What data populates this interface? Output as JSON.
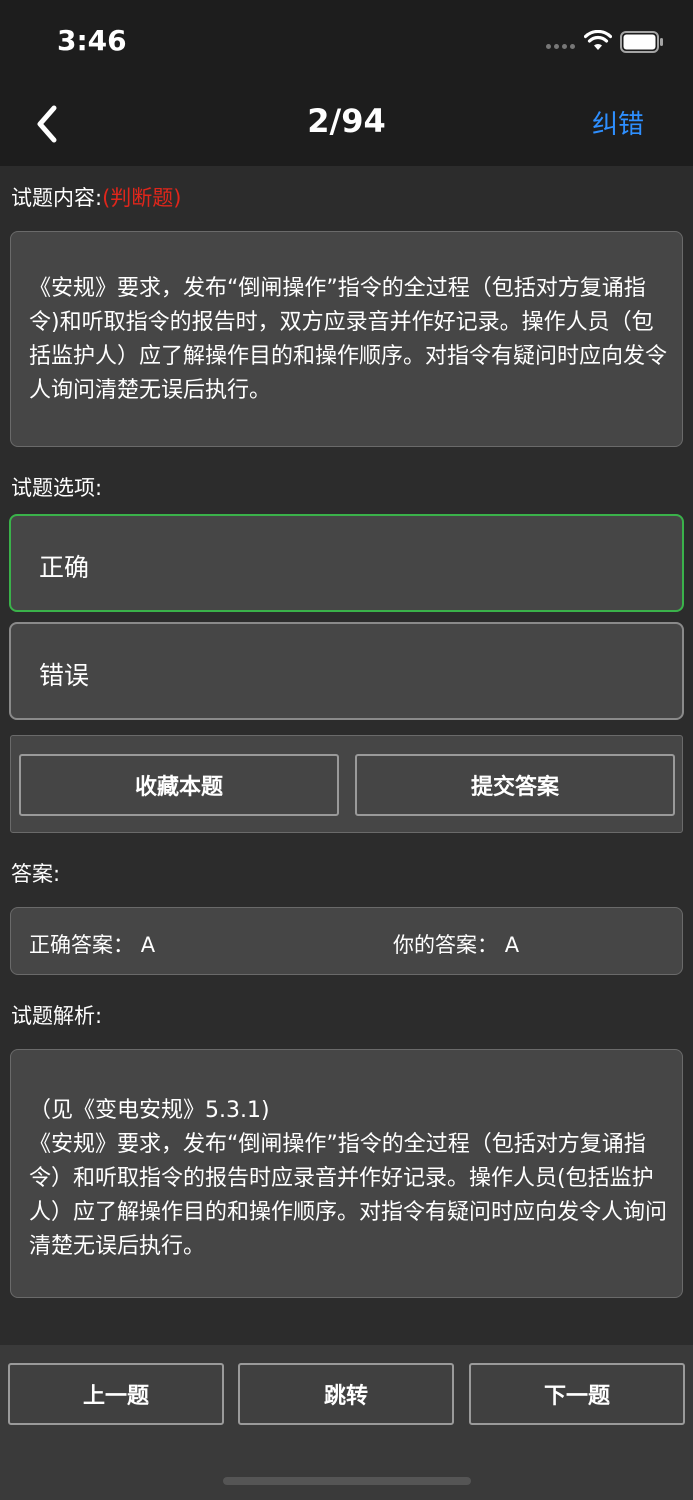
{
  "status_bar": {
    "time": "3:46"
  },
  "nav": {
    "title": "2/94",
    "action_label": "纠错"
  },
  "question": {
    "label": "试题内容:",
    "type_label": "(判断题)",
    "text": "《安规》要求，发布“倒闸操作”指令的全过程（包括对方复诵指令)和听取指令的报告时，双方应录音并作好记录。操作人员（包括监护人）应了解操作目的和操作顺序。对指令有疑问时应向发令人询问清楚无误后执行。"
  },
  "options": {
    "label": "试题选项:",
    "items": [
      {
        "label": "正确",
        "selected": true
      },
      {
        "label": "错误",
        "selected": false
      }
    ]
  },
  "actions": {
    "favorite_label": "收藏本题",
    "submit_label": "提交答案"
  },
  "answer": {
    "label": "答案:",
    "correct_label": "正确答案：",
    "correct_value": "A",
    "yours_label": "你的答案：",
    "yours_value": "A"
  },
  "analysis": {
    "label": "试题解析:",
    "text": "（见《变电安规》5.3.1)\n《安规》要求，发布“倒闸操作”指令的全过程（包括对方复诵指令）和听取指令的报告时应录音并作好记录。操作人员(包括监护人）应了解操作目的和操作顺序。对指令有疑问时应向发令人询问清楚无误后执行。"
  },
  "bottom": {
    "prev_label": "上一题",
    "jump_label": "跳转",
    "next_label": "下一题"
  },
  "colors": {
    "accent": "#2e8fff",
    "type_label": "#e0261b",
    "selected_border": "#3ab24a"
  }
}
